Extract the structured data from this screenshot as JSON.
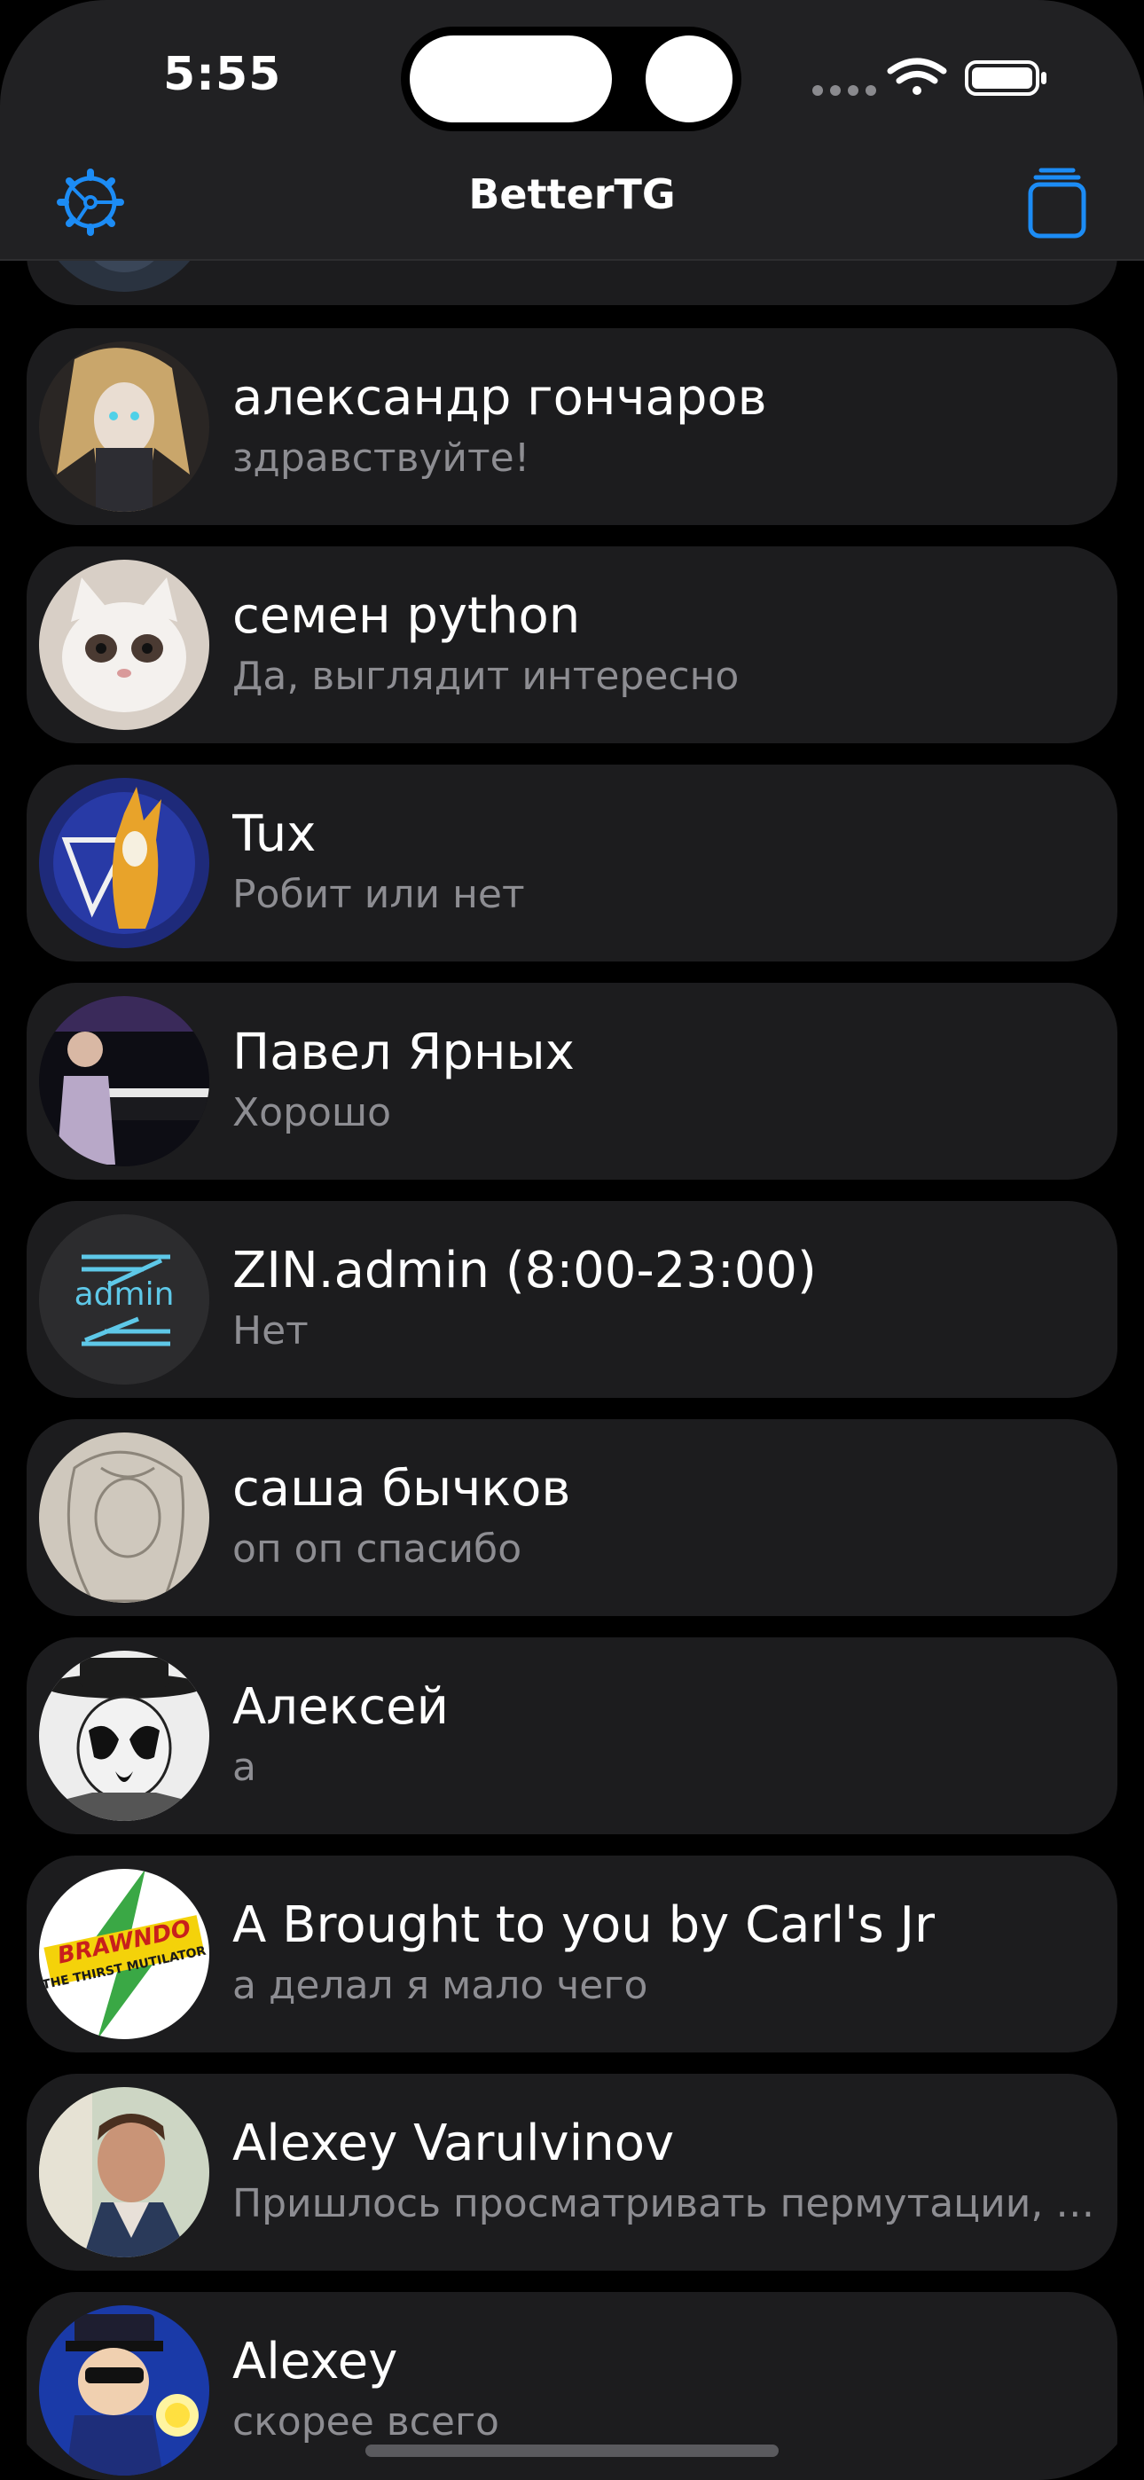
{
  "status_bar": {
    "time": "5:55",
    "icons": [
      "cellular-dots-icon",
      "wifi-icon",
      "battery-icon"
    ]
  },
  "nav": {
    "title": "BetterTG",
    "left_icon": "gear-icon",
    "right_icon": "new-chat-icon",
    "accent": "#1c8cf5"
  },
  "chats": [
    {
      "name": "",
      "preview": "",
      "avatar": "dark-figure"
    },
    {
      "name": "александр гончаров",
      "preview": "здравствуйте!",
      "avatar": "anime-character"
    },
    {
      "name": "семен python",
      "preview": "Да, выглядит интересно",
      "avatar": "cat"
    },
    {
      "name": "Tux",
      "preview": "Робит или нет",
      "avatar": "fox-character"
    },
    {
      "name": "Павел Ярных",
      "preview": "Хорошо",
      "avatar": "pianist"
    },
    {
      "name": "ZIN.admin (8:00-23:00)",
      "preview": "Нет",
      "avatar": "admin-logo",
      "avatar_text": "admin"
    },
    {
      "name": "саша бычков",
      "preview": "оп оп спасибо",
      "avatar": "pencil-sketch"
    },
    {
      "name": "Алексей",
      "preview": "а",
      "avatar": "rorschach"
    },
    {
      "name": "A Brought to you by Carl's Jr",
      "preview": "а делал я мало чего",
      "avatar": "brawndo-logo",
      "avatar_text": "BRAWNDO",
      "avatar_subtext": "THE THIRST MUTILATOR"
    },
    {
      "name": "Alexey Varulvinov",
      "preview": "Пришлось просматривать пермутации, а потом я не очень понимал",
      "avatar": "man-portrait"
    },
    {
      "name": "Alexey",
      "preview": "скорее всего",
      "avatar": "cartoon-policeman"
    }
  ],
  "colors": {
    "background": "#000000",
    "card": "#1c1c1e",
    "name": "#ffffff",
    "preview": "#8d8d92",
    "header": "#212123"
  }
}
